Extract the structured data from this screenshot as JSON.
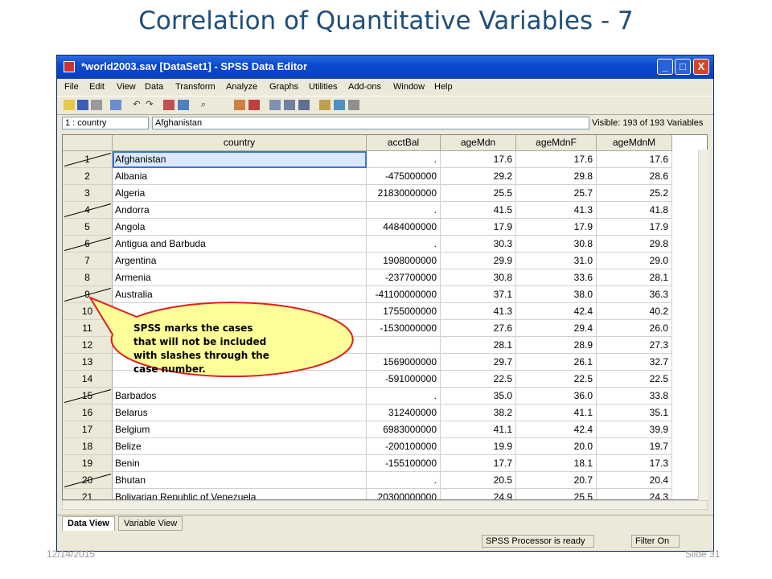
{
  "slide": {
    "title": "Correlation of Quantitative Variables - 7",
    "date": "12/14/2015",
    "slide_number": "Slide 31"
  },
  "window": {
    "title": "*world2003.sav [DataSet1] - SPSS Data Editor",
    "minimize": "_",
    "maximize": "□",
    "close": "X"
  },
  "menu": [
    "File",
    "Edit",
    "View",
    "Data",
    "Transform",
    "Analyze",
    "Graphs",
    "Utilities",
    "Add-ons",
    "Window",
    "Help"
  ],
  "cell_editor": {
    "ref": "1 : country",
    "value": "Afghanistan",
    "visible": "Visible: 193 of 193 Variables"
  },
  "columns": [
    "country",
    "acctBal",
    "ageMdn",
    "ageMdnF",
    "ageMdnM"
  ],
  "rows": [
    {
      "n": "1",
      "country": "Afghanistan",
      "acctBal": ".",
      "ageMdn": "17.6",
      "ageMdnF": "17.6",
      "ageMdnM": "17.6",
      "slashed": true
    },
    {
      "n": "2",
      "country": "Albania",
      "acctBal": "-475000000",
      "ageMdn": "29.2",
      "ageMdnF": "29.8",
      "ageMdnM": "28.6",
      "slashed": false
    },
    {
      "n": "3",
      "country": "Algeria",
      "acctBal": "21830000000",
      "ageMdn": "25.5",
      "ageMdnF": "25.7",
      "ageMdnM": "25.2",
      "slashed": false
    },
    {
      "n": "4",
      "country": "Andorra",
      "acctBal": ".",
      "ageMdn": "41.5",
      "ageMdnF": "41.3",
      "ageMdnM": "41.8",
      "slashed": true
    },
    {
      "n": "5",
      "country": "Angola",
      "acctBal": "4484000000",
      "ageMdn": "17.9",
      "ageMdnF": "17.9",
      "ageMdnM": "17.9",
      "slashed": false
    },
    {
      "n": "6",
      "country": "Antigua and Barbuda",
      "acctBal": ".",
      "ageMdn": "30.3",
      "ageMdnF": "30.8",
      "ageMdnM": "29.8",
      "slashed": true
    },
    {
      "n": "7",
      "country": "Argentina",
      "acctBal": "1908000000",
      "ageMdn": "29.9",
      "ageMdnF": "31.0",
      "ageMdnM": "29.0",
      "slashed": false
    },
    {
      "n": "8",
      "country": "Armenia",
      "acctBal": "-237700000",
      "ageMdn": "30.8",
      "ageMdnF": "33.6",
      "ageMdnM": "28.1",
      "slashed": false
    },
    {
      "n": "9",
      "country": "Australia",
      "acctBal": "-41100000000",
      "ageMdn": "37.1",
      "ageMdnF": "38.0",
      "ageMdnM": "36.3",
      "slashed": true
    },
    {
      "n": "10",
      "country": "",
      "acctBal": "1755000000",
      "ageMdn": "41.3",
      "ageMdnF": "42.4",
      "ageMdnM": "40.2",
      "slashed": false
    },
    {
      "n": "11",
      "country": "Az",
      "acctBal": "-1530000000",
      "ageMdn": "27.6",
      "ageMdnF": "29.4",
      "ageMdnM": "26.0",
      "slashed": false
    },
    {
      "n": "12",
      "country": "",
      "acctBal": "",
      "ageMdn": "28.1",
      "ageMdnF": "28.9",
      "ageMdnM": "27.3",
      "slashed": false
    },
    {
      "n": "13",
      "country": "",
      "acctBal": "1569000000",
      "ageMdn": "29.7",
      "ageMdnF": "26.1",
      "ageMdnM": "32.7",
      "slashed": false
    },
    {
      "n": "14",
      "country": "",
      "acctBal": "-591000000",
      "ageMdn": "22.5",
      "ageMdnF": "22.5",
      "ageMdnM": "22.5",
      "slashed": false
    },
    {
      "n": "15",
      "country": "Barbados",
      "acctBal": ".",
      "ageMdn": "35.0",
      "ageMdnF": "36.0",
      "ageMdnM": "33.8",
      "slashed": true
    },
    {
      "n": "16",
      "country": "Belarus",
      "acctBal": "312400000",
      "ageMdn": "38.2",
      "ageMdnF": "41.1",
      "ageMdnM": "35.1",
      "slashed": false
    },
    {
      "n": "17",
      "country": "Belgium",
      "acctBal": "6983000000",
      "ageMdn": "41.1",
      "ageMdnF": "42.4",
      "ageMdnM": "39.9",
      "slashed": false
    },
    {
      "n": "18",
      "country": "Belize",
      "acctBal": "-200100000",
      "ageMdn": "19.9",
      "ageMdnF": "20.0",
      "ageMdnM": "19.7",
      "slashed": false
    },
    {
      "n": "19",
      "country": "Benin",
      "acctBal": "-155100000",
      "ageMdn": "17.7",
      "ageMdnF": "18.1",
      "ageMdnM": "17.3",
      "slashed": false
    },
    {
      "n": "20",
      "country": "Bhutan",
      "acctBal": ".",
      "ageMdn": "20.5",
      "ageMdnF": "20.7",
      "ageMdnM": "20.4",
      "slashed": true
    },
    {
      "n": "21",
      "country": "Bolivarian Republic of Venezuela",
      "acctBal": "20300000000",
      "ageMdn": "24.9",
      "ageMdnF": "25.5",
      "ageMdnM": "24.3",
      "slashed": false
    }
  ],
  "tabs": {
    "data_view": "Data View",
    "variable_view": "Variable View"
  },
  "status": {
    "processor": "SPSS  Processor is ready",
    "filter": "Filter On"
  },
  "callout": {
    "text": "SPSS marks the cases that will not be included with slashes through the case number."
  },
  "colors": {
    "title": "#1f4e79",
    "callout_fill": "#ffff99",
    "callout_border": "#e02020"
  }
}
